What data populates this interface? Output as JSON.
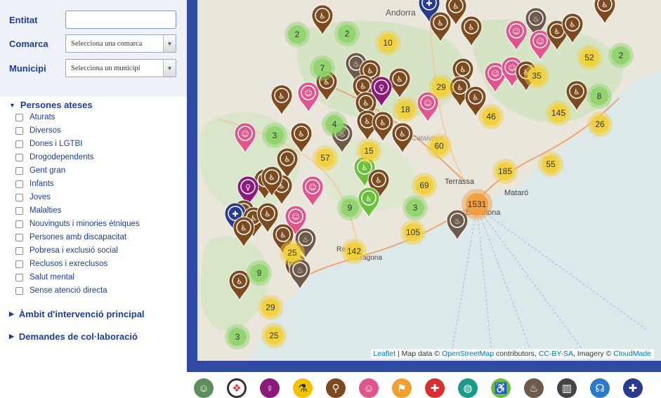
{
  "filters": {
    "entitat_label": "Entitat",
    "entitat_value": "",
    "comarca_label": "Comarca",
    "comarca_value": "Selecciona una comarca",
    "municipi_label": "Municipi",
    "municipi_value": "Selecciona un municipi"
  },
  "sections": {
    "persones_ateses": {
      "title": "Persones ateses",
      "items": [
        "Aturats",
        "Diversos",
        "Dones i LGTBI",
        "Drogodependents",
        "Gent gran",
        "Infants",
        "Joves",
        "Malalties",
        "Nouvinguts i minories ètniques",
        "Persones amb discapacitat",
        "Pobresa i exclusió social",
        "Reclusos i exreclusos",
        "Salut mental",
        "Sense atenció directa"
      ]
    },
    "ambit_title": "Àmbit d'intervenció principal",
    "demandes_title": "Demandes de col·laboració"
  },
  "map": {
    "places": [
      "Andorra",
      "Terrassa",
      "Mataró",
      "Barcelona",
      "Tarragona",
      "Reus",
      "Catalunya"
    ],
    "cluster_counts": [
      "2",
      "2",
      "10",
      "52",
      "2",
      "7",
      "29",
      "35",
      "18",
      "46",
      "145",
      "8",
      "26",
      "3",
      "4",
      "60",
      "57",
      "15",
      "185",
      "55",
      "69",
      "9",
      "3",
      "1531",
      "105",
      "25",
      "142",
      "9",
      "29",
      "3",
      "25"
    ],
    "marker_types": [
      "gent-gran",
      "infants",
      "dones",
      "pobresa",
      "discapacitat",
      "sense-atencio"
    ],
    "attribution": {
      "leaflet": "Leaflet",
      "sep1": " | Map data © ",
      "osm": "OpenStreetMap",
      "sep2": " contributors, ",
      "license": "CC-BY-SA",
      "sep3": ", Imagery © ",
      "imagery": "CloudMade"
    }
  },
  "colors": {
    "gent_gran": "#7b4a1e",
    "infants": "#e0558c",
    "dones": "#8b1a7a",
    "pobresa": "#6e5a4a",
    "discapacitat": "#6cbf3a",
    "sense_atencio": "#2a3a8c",
    "cluster_small": "#8ed36a",
    "cluster_medium": "#f1cf3a",
    "cluster_large": "#f29c3a"
  },
  "bottom_icons": [
    "aturats-icon",
    "diversos-icon",
    "dones-icon",
    "drogodependents-icon",
    "gent-gran-icon",
    "infants-icon",
    "joves-icon",
    "malalties-icon",
    "nouvinguts-icon",
    "discapacitat-icon",
    "pobresa-icon",
    "reclusos-icon",
    "salut-mental-icon",
    "sense-atencio-icon"
  ]
}
